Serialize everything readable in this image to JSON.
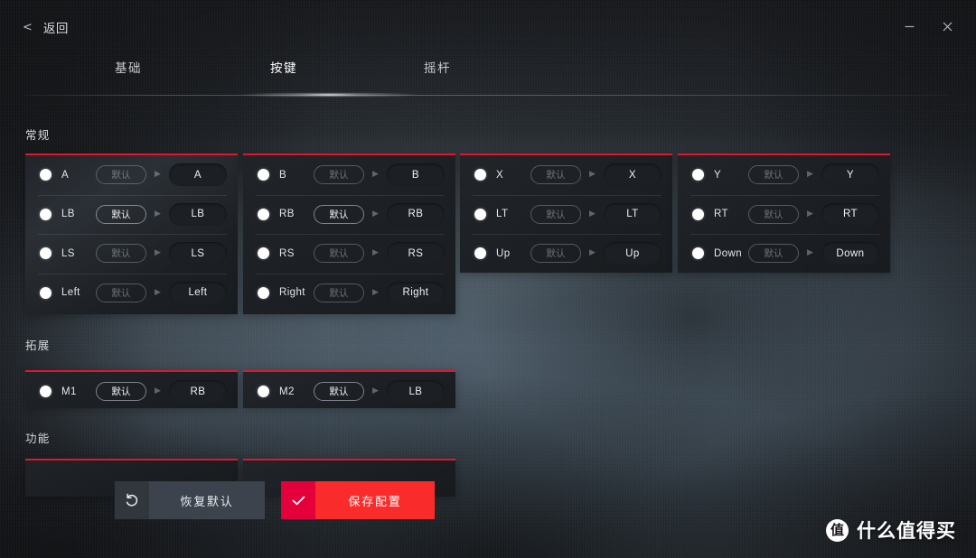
{
  "window": {
    "back_label": "返回",
    "back_icon": "chevron-left-icon",
    "minimize_icon": "minimize-icon",
    "close_icon": "close-icon"
  },
  "tabs": [
    {
      "label": "基础",
      "active": false
    },
    {
      "label": "按键",
      "active": true
    },
    {
      "label": "摇杆",
      "active": false
    }
  ],
  "sections": {
    "normal": {
      "label": "常规"
    },
    "expand": {
      "label": "拓展"
    },
    "function": {
      "label": "功能"
    }
  },
  "labels": {
    "default_pill": "默认",
    "arrow_glyph": "▶"
  },
  "groups": {
    "normal": [
      {
        "rows": [
          {
            "key": "A",
            "default": "默认",
            "mapped": "A",
            "highlighted": false
          },
          {
            "key": "LB",
            "default": "默认",
            "mapped": "LB",
            "highlighted": true
          },
          {
            "key": "LS",
            "default": "默认",
            "mapped": "LS",
            "highlighted": false
          },
          {
            "key": "Left",
            "default": "默认",
            "mapped": "Left",
            "highlighted": false
          }
        ]
      },
      {
        "rows": [
          {
            "key": "B",
            "default": "默认",
            "mapped": "B",
            "highlighted": false
          },
          {
            "key": "RB",
            "default": "默认",
            "mapped": "RB",
            "highlighted": true
          },
          {
            "key": "RS",
            "default": "默认",
            "mapped": "RS",
            "highlighted": false
          },
          {
            "key": "Right",
            "default": "默认",
            "mapped": "Right",
            "highlighted": false
          }
        ]
      },
      {
        "rows": [
          {
            "key": "X",
            "default": "默认",
            "mapped": "X",
            "highlighted": false
          },
          {
            "key": "LT",
            "default": "默认",
            "mapped": "LT",
            "highlighted": false
          },
          {
            "key": "Up",
            "default": "默认",
            "mapped": "Up",
            "highlighted": false
          }
        ]
      },
      {
        "rows": [
          {
            "key": "Y",
            "default": "默认",
            "mapped": "Y",
            "highlighted": false
          },
          {
            "key": "RT",
            "default": "默认",
            "mapped": "RT",
            "highlighted": false
          },
          {
            "key": "Down",
            "default": "默认",
            "mapped": "Down",
            "highlighted": false
          }
        ]
      }
    ],
    "expand": [
      {
        "rows": [
          {
            "key": "M1",
            "default": "默认",
            "mapped": "RB",
            "highlighted": true
          }
        ]
      },
      {
        "rows": [
          {
            "key": "M2",
            "default": "默认",
            "mapped": "LB",
            "highlighted": true
          }
        ]
      }
    ],
    "function": [
      {
        "rows": []
      },
      {
        "rows": []
      }
    ]
  },
  "footer": {
    "restore": {
      "label": "恢复默认",
      "icon": "undo-icon"
    },
    "save": {
      "label": "保存配置",
      "icon": "check-icon"
    }
  },
  "watermark": {
    "logo_glyph": "值",
    "text": "什么值得买"
  },
  "colors": {
    "accent_red": "#e0162c",
    "save_red": "#fa2b2b",
    "save_red_dark": "#e4003a",
    "card_bg": "#20232 7",
    "restore_gray": "#3c434c"
  }
}
